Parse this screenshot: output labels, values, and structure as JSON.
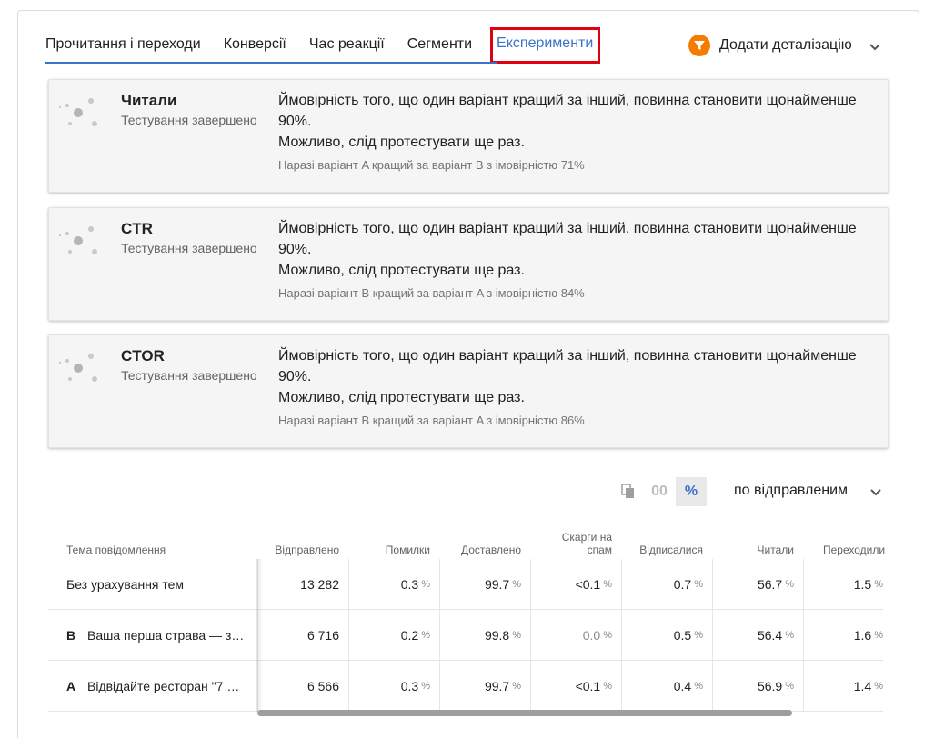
{
  "tabs": [
    {
      "label": "Прочитання і переходи"
    },
    {
      "label": "Конверсії"
    },
    {
      "label": "Час реакції"
    },
    {
      "label": "Сегменти"
    },
    {
      "label": "Експерименти",
      "active": true
    }
  ],
  "add_detail": {
    "label": "Додати деталізацію",
    "icon": "funnel-icon",
    "color": "#f57c00"
  },
  "cards": [
    {
      "title": "Читали",
      "subtitle": "Тестування завершено",
      "message_line1": "Ймовірність того, що один варіант кращий за інший, повинна становити щонайменше 90%.",
      "message_line2": "Можливо, слід протестувати ще раз.",
      "note": "Наразі варіант A кращий за варіант B з імовірністю 71%"
    },
    {
      "title": "CTR",
      "subtitle": "Тестування завершено",
      "message_line1": "Ймовірність того, що один варіант кращий за інший, повинна становити щонайменше 90%.",
      "message_line2": "Можливо, слід протестувати ще раз.",
      "note": "Наразі варіант B кращий за варіант A з імовірністю 84%"
    },
    {
      "title": "CTOR",
      "subtitle": "Тестування завершено",
      "message_line1": "Ймовірність того, що один варіант кращий за інший, повинна становити щонайменше 90%.",
      "message_line2": "Можливо, слід протестувати ще раз.",
      "note": "Наразі варіант B кращий за варіант A з імовірністю 86%"
    }
  ],
  "controls": {
    "copy_icon": "copy-icon",
    "abs_label": "00",
    "pct_label": "%",
    "basis_label": "по відправленим"
  },
  "table": {
    "headers": {
      "subject": "Тема повідомлення",
      "sent": "Відправлено",
      "errors": "Помилки",
      "delivered": "Доставлено",
      "spam": "Скарги на спам",
      "unsubscribed": "Відписалися",
      "read": "Читали",
      "clicked": "Переходили"
    },
    "unit": "%",
    "rows": [
      {
        "variant": "",
        "subject": "Без урахування тем",
        "sent": "13 282",
        "errors": "0.3",
        "delivered": "99.7",
        "spam": "<0.1",
        "unsubscribed": "0.7",
        "read": "56.7",
        "clicked": "1.5"
      },
      {
        "variant": "B",
        "subject": "Ваша перша страва — з…",
        "sent": "6 716",
        "errors": "0.2",
        "delivered": "99.8",
        "spam": "0.0",
        "unsubscribed": "0.5",
        "read": "56.4",
        "clicked": "1.6"
      },
      {
        "variant": "A",
        "subject": "Відвідайте ресторан \"7 …",
        "sent": "6 566",
        "errors": "0.3",
        "delivered": "99.7",
        "spam": "<0.1",
        "unsubscribed": "0.4",
        "read": "56.9",
        "clicked": "1.4"
      }
    ]
  }
}
